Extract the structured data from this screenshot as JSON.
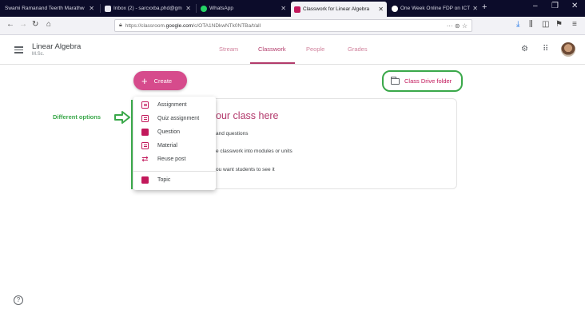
{
  "browser": {
    "tabs": [
      {
        "title": "Swami Ramanand Teerth Marathw",
        "active": false
      },
      {
        "title": "Inbox (2) - sarcxxba.phd@gm",
        "active": false
      },
      {
        "title": "WhatsApp",
        "active": false
      },
      {
        "title": "Classwork for Linear Algebra",
        "active": true
      },
      {
        "title": "One Week Online FDP on ICT",
        "active": false
      }
    ],
    "new_tab": "+",
    "window_controls": [
      "–",
      "❐",
      "✕"
    ],
    "url_host_prefix": "https://classroom.",
    "url_host": "google.com",
    "url_path": "/c/OTA1NDkwNTk0NTBa/t/all",
    "url_more": "··· ⊚ ☆"
  },
  "app": {
    "class_name": "Linear Algebra",
    "section": "M.Sc.",
    "tabs": [
      "Stream",
      "Classwork",
      "People",
      "Grades"
    ],
    "active_tab": "Classwork"
  },
  "toolbar": {
    "create_label": "Create",
    "drive_folder_label": "Class Drive folder"
  },
  "create_menu": {
    "items": [
      {
        "label": "Assignment",
        "icon": "assignment-icon"
      },
      {
        "label": "Quiz assignment",
        "icon": "quiz-assignment-icon"
      },
      {
        "label": "Question",
        "icon": "question-icon"
      },
      {
        "label": "Material",
        "icon": "material-icon"
      },
      {
        "label": "Reuse post",
        "icon": "reuse-post-icon"
      },
      {
        "label": "Topic",
        "icon": "topic-icon"
      }
    ]
  },
  "empty_card": {
    "title": "our class here",
    "line1": "and questions",
    "line2": "e classwork into modules or units",
    "line3": "ou want students to see it"
  },
  "annotation": {
    "label": "Different options",
    "color": "#3aa84a"
  },
  "colors": {
    "accent": "#d64b8c",
    "brand_text": "#b23b6b"
  }
}
